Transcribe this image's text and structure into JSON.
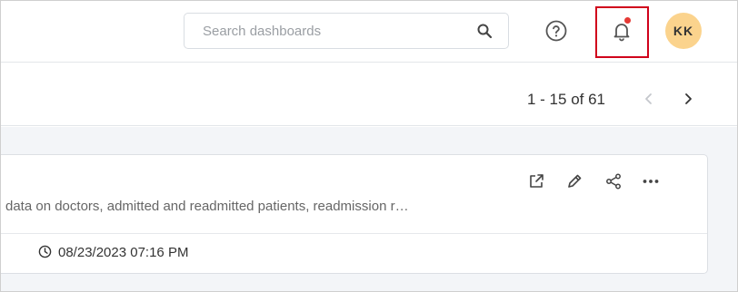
{
  "header": {
    "search": {
      "placeholder": "Search dashboards",
      "value": ""
    },
    "avatar_initials": "KK",
    "notification_dot_color": "#e53935",
    "highlight_color": "#d0021b"
  },
  "pagination": {
    "label": "1 - 15 of 61"
  },
  "card": {
    "description": "data on doctors, admitted and readmitted patients, readmission r…",
    "timestamp": "08/23/2023 07:16 PM"
  },
  "icons": {
    "search": "search-icon",
    "help": "help-circle-icon",
    "bell": "bell-icon",
    "prev": "chevron-left-icon",
    "next": "chevron-right-icon",
    "open": "external-link-icon",
    "edit": "pencil-icon",
    "share": "share-icon",
    "more": "more-horizontal-icon",
    "clock": "clock-icon"
  }
}
